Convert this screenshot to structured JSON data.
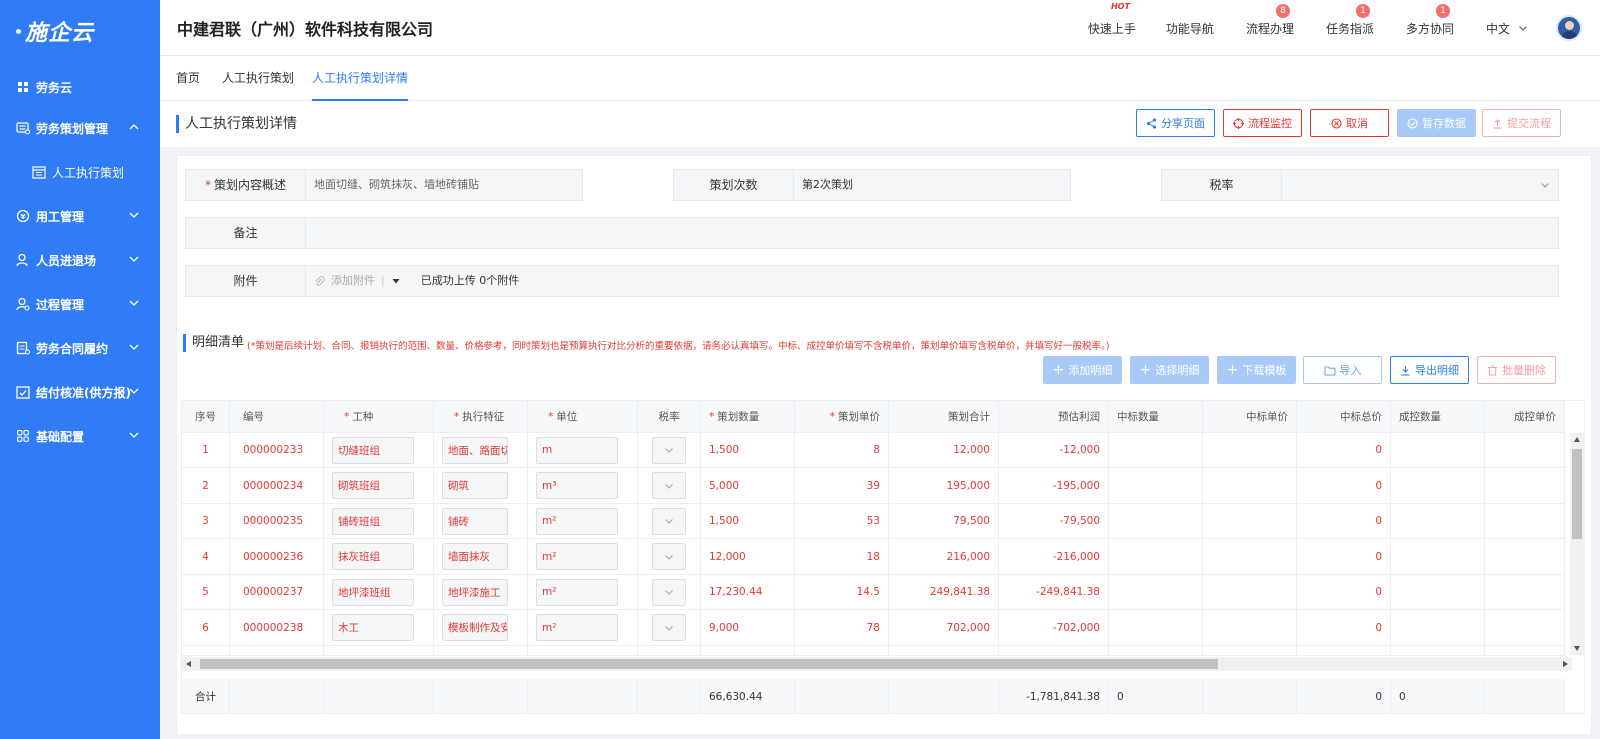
{
  "app": {
    "logo": "施企云",
    "company": "中建君联（广州）软件科技有限公司"
  },
  "sidebar": {
    "items": [
      {
        "label": "劳务云",
        "icon": "grid-icon"
      },
      {
        "label": "劳务策划管理",
        "icon": "stack-icon",
        "expanded": true
      },
      {
        "label": "人工执行策划",
        "icon": "calendar-icon",
        "sub": true
      },
      {
        "label": "用工管理",
        "icon": "coin-icon"
      },
      {
        "label": "人员进退场",
        "icon": "user-icon"
      },
      {
        "label": "过程管理",
        "icon": "user-gear-icon"
      },
      {
        "label": "劳务合同履约",
        "icon": "contract-icon"
      },
      {
        "label": "结付核准(供方报)",
        "icon": "check-calendar-icon"
      },
      {
        "label": "基础配置",
        "icon": "apps-icon"
      }
    ]
  },
  "header": {
    "nav": [
      {
        "label": "快速上手",
        "hot": "HOT"
      },
      {
        "label": "功能导航"
      },
      {
        "label": "流程办理",
        "badge": "8"
      },
      {
        "label": "任务指派",
        "badge": "1"
      },
      {
        "label": "多方协同",
        "badge": "1"
      },
      {
        "label": "中文"
      }
    ]
  },
  "tabs": [
    "首页",
    "人工执行策划",
    "人工执行策划详情"
  ],
  "page": {
    "title": "人工执行策划详情",
    "buttons": {
      "share": "分享页面",
      "monitor": "流程监控",
      "cancel": "取消",
      "save": "暂存数据",
      "submit": "提交流程"
    }
  },
  "form": {
    "content_label": "策划内容概述",
    "content_value": "地面切缝、砌筑抹灰、墙地砖铺贴",
    "count_label": "策划次数",
    "count_value": "第2次策划",
    "tax_label": "税率",
    "tax_value": "",
    "remark_label": "备注",
    "remark_value": "",
    "attach_label": "附件",
    "attach_add": "添加附件",
    "attach_status": "已成功上传 0个附件"
  },
  "detail": {
    "title": "明细清单",
    "note": "(*策划是后续计划、合同、报销执行的范围、数量、价格参考，同时策划也是预算执行对比分析的重要依据，请务必认真填写。中标、成控单价填写不含税单价，策划单价填写含税单价，并填写好一般税率。)",
    "buttons": {
      "add": "添加明细",
      "select": "选择明细",
      "download": "下载模板",
      "import": "导入",
      "export": "导出明细",
      "delete": "批量删除"
    },
    "columns": [
      "序号",
      "编号",
      "工种",
      "执行特征",
      "单位",
      "税率",
      "策划数量",
      "策划单价",
      "策划合计",
      "预估利润",
      "中标数量",
      "中标单价",
      "中标总价",
      "成控数量",
      "成控单价"
    ],
    "required_columns": [
      "工种",
      "执行特征",
      "单位",
      "策划数量",
      "策划单价"
    ],
    "rows": [
      {
        "no": "1",
        "code": "000000233",
        "trade": "切缝班组",
        "feature": "地面、路面切缝",
        "unit": "m",
        "qty": "1,500",
        "price": "8",
        "total": "12,000",
        "profit": "-12,000",
        "bid_total": "0"
      },
      {
        "no": "2",
        "code": "000000234",
        "trade": "砌筑班组",
        "feature": "砌筑",
        "unit": "m³",
        "qty": "5,000",
        "price": "39",
        "total": "195,000",
        "profit": "-195,000",
        "bid_total": "0"
      },
      {
        "no": "3",
        "code": "000000235",
        "trade": "铺砖班组",
        "feature": "铺砖",
        "unit": "m²",
        "qty": "1,500",
        "price": "53",
        "total": "79,500",
        "profit": "-79,500",
        "bid_total": "0"
      },
      {
        "no": "4",
        "code": "000000236",
        "trade": "抹灰班组",
        "feature": "墙面抹灰",
        "unit": "m²",
        "qty": "12,000",
        "price": "18",
        "total": "216,000",
        "profit": "-216,000",
        "bid_total": "0"
      },
      {
        "no": "5",
        "code": "000000237",
        "trade": "地坪漆班组",
        "feature": "地坪漆施工",
        "unit": "m²",
        "qty": "17,230.44",
        "price": "14.5",
        "total": "249,841.38",
        "profit": "-249,841.38",
        "bid_total": "0"
      },
      {
        "no": "6",
        "code": "000000238",
        "trade": "木工",
        "feature": "模板制作及安装",
        "unit": "m²",
        "qty": "9,000",
        "price": "78",
        "total": "702,000",
        "profit": "-702,000",
        "bid_total": "0"
      }
    ],
    "footer": {
      "label": "合计",
      "qty": "66,630.44",
      "profit": "-1,781,841.38",
      "bid_qty": "0",
      "bid_total": "0",
      "ctrl_qty": "0"
    }
  },
  "colors": {
    "primary": "#2f7cf6",
    "danger": "#e53935",
    "sidebar": "#2f7cf6"
  }
}
